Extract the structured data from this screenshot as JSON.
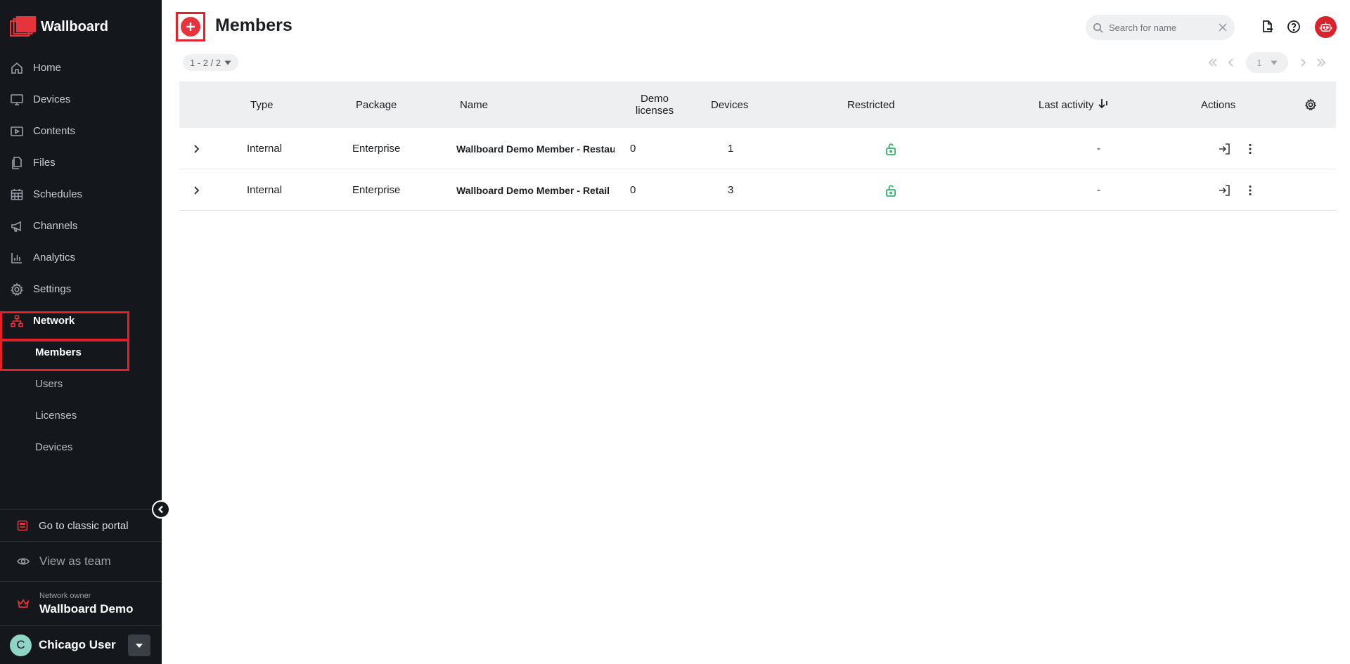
{
  "app": {
    "brand": "Wallboard",
    "accent": "#e5343c"
  },
  "sidebar": {
    "items": [
      {
        "label": "Home",
        "icon": "home-icon"
      },
      {
        "label": "Devices",
        "icon": "monitor-icon"
      },
      {
        "label": "Contents",
        "icon": "play-icon"
      },
      {
        "label": "Files",
        "icon": "files-icon"
      },
      {
        "label": "Schedules",
        "icon": "calendar-icon"
      },
      {
        "label": "Channels",
        "icon": "megaphone-icon"
      },
      {
        "label": "Analytics",
        "icon": "bar-chart-icon"
      },
      {
        "label": "Settings",
        "icon": "gear-icon"
      },
      {
        "label": "Network",
        "icon": "network-icon"
      }
    ],
    "network_sub": [
      {
        "label": "Members",
        "active": true
      },
      {
        "label": "Users"
      },
      {
        "label": "Licenses"
      },
      {
        "label": "Devices"
      }
    ],
    "classic_portal": "Go to classic portal",
    "view_as_team": "View as team",
    "owner_label": "Network owner",
    "owner_name": "Wallboard Demo",
    "user_initial": "C",
    "user_name": "Chicago User"
  },
  "header": {
    "title": "Members",
    "search_placeholder": "Search for name"
  },
  "pagination": {
    "range": "1 - 2 / 2",
    "page": "1"
  },
  "table": {
    "columns": {
      "type": "Type",
      "package": "Package",
      "name": "Name",
      "demo_licenses": "Demo licenses",
      "devices": "Devices",
      "restricted": "Restricted",
      "last_activity": "Last activity",
      "actions": "Actions"
    },
    "rows": [
      {
        "type": "Internal",
        "package": "Enterprise",
        "name": "Wallboard Demo Member - Restaurant",
        "demo_licenses": "0",
        "devices": "1",
        "restricted": "unlocked",
        "last_activity": "-"
      },
      {
        "type": "Internal",
        "package": "Enterprise",
        "name": "Wallboard Demo Member - Retail",
        "demo_licenses": "0",
        "devices": "3",
        "restricted": "unlocked",
        "last_activity": "-"
      }
    ]
  }
}
